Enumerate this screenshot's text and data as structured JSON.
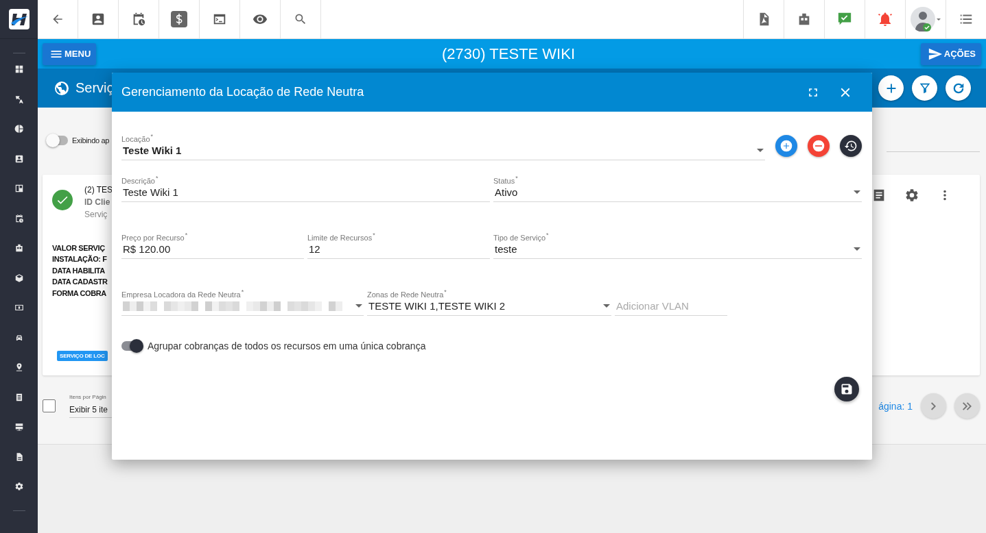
{
  "topbar": {
    "menu_button": "MENU",
    "title": "(2730) TESTE WIKI",
    "actions_button": "AÇÕES"
  },
  "page_header": {
    "title": "Serviç"
  },
  "filter": {
    "toggle_label": "Exibindo ap",
    "toggle_on": false
  },
  "card": {
    "title": "(2) TES",
    "client_id": "ID Clie",
    "service": "Serviç",
    "details": [
      "VALOR SERVIÇ",
      "INSTALAÇÃO: F",
      "DATA HABILITA",
      "DATA CADASTR",
      "FORMA COBRA"
    ],
    "tag": "SERVIÇO DE LOC"
  },
  "pagination": {
    "select_all_checked": false,
    "items_label": "Itens por Págin",
    "items_value": "Exibir 5 ite",
    "page_label": "ágina: 1"
  },
  "modal": {
    "title": "Gerenciamento da Locação de Rede Neutra",
    "rows": [
      {
        "fields": [
          {
            "kind": "select",
            "label": "Locação",
            "mark": "*",
            "value": "Teste Wiki 1",
            "bold": true
          }
        ]
      },
      {
        "fields": [
          {
            "kind": "input",
            "label": "Descrição",
            "mark": "*",
            "value": "Teste Wiki 1",
            "bold": false
          },
          {
            "kind": "select",
            "label": "Status",
            "mark": "*",
            "value": "Ativo",
            "bold": false
          }
        ]
      },
      {
        "fields": [
          {
            "kind": "input",
            "label": "Preço por Recurso",
            "mark": "*",
            "value": "R$ 120.00",
            "bold": false
          },
          {
            "kind": "input",
            "label": "Limite de Recursos",
            "mark": "*",
            "value": "12",
            "bold": false
          },
          {
            "kind": "select",
            "label": "Tipo de Serviço",
            "mark": "*",
            "value": "teste",
            "bold": false
          }
        ]
      },
      {
        "fields": [
          {
            "kind": "redacted",
            "label": "Empresa Locadora da Rede Neutra",
            "mark": "*"
          },
          {
            "kind": "select",
            "label": "Zonas de Rede Neutra",
            "mark": "*",
            "value": "TESTE WIKI 1,TESTE WIKI 2",
            "bold": false
          },
          {
            "kind": "input",
            "placeholder": "Adicionar VLAN"
          }
        ]
      }
    ],
    "group_toggle": {
      "label": "Agrupar cobranças de todos os recursos em uma única cobrança",
      "on": true
    }
  }
}
